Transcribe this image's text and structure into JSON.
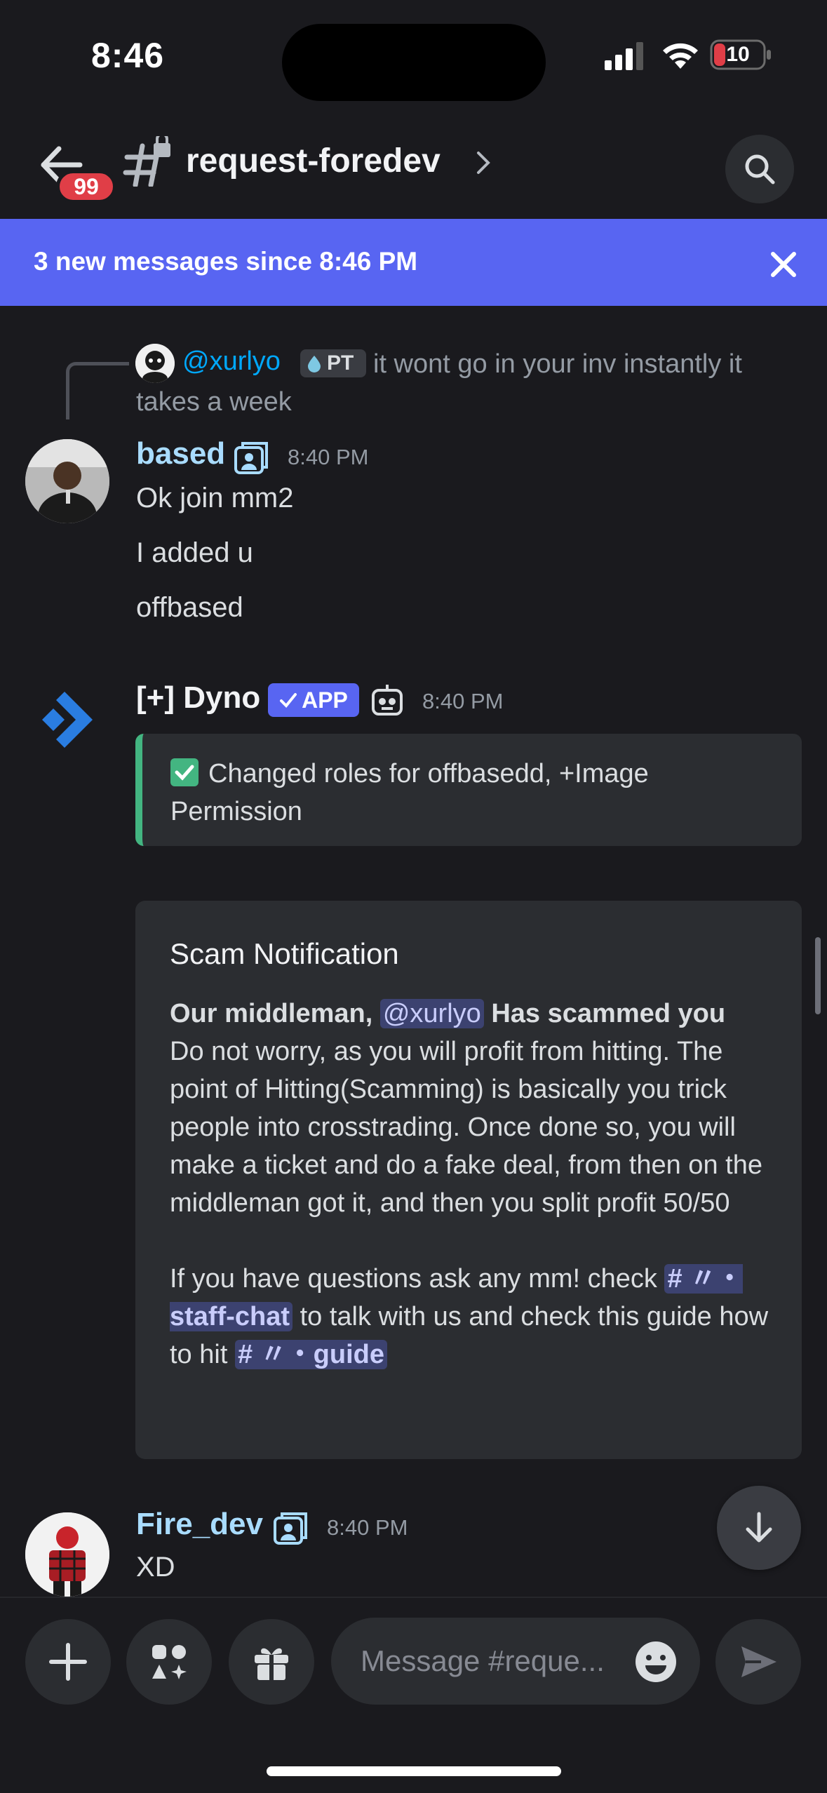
{
  "status": {
    "time": "8:46",
    "battery": "10"
  },
  "header": {
    "unread_badge": "99",
    "channel_name": "request-foredev"
  },
  "banner": {
    "text": "3 new messages since 8:46 PM"
  },
  "reply": {
    "user": "@xurlyo",
    "tag": "PT",
    "text": "it wont go in your inv instantly it takes a week"
  },
  "messages": {
    "based": {
      "username": "based",
      "username_color": "#a9dcff",
      "time": "8:40 PM",
      "lines": [
        "Ok join mm2",
        "I added u",
        "offbased"
      ]
    },
    "dyno": {
      "username": "[+] Dyno",
      "app_tag": "APP",
      "time": "8:40 PM",
      "embed1_text": "Changed roles for offbasedd, +Image Permission",
      "embed2": {
        "title": "Scam Notification",
        "bold_lead": "Our middleman,",
        "mention": "@xurlyo",
        "bold_tail": "Has scammed you",
        "para1": "Do not worry, as you will profit from hitting. The point of Hitting(Scamming) is basically you trick people into crosstrading. Once done so, you will make a ticket and do a fake deal, from then on the middleman got it, and then you split profit 50/50",
        "para2_a": "If you have questions ask any mm! check",
        "channel1": "# 〃・staff-chat",
        "para2_b": "to talk with us and check this guide how to hit",
        "channel2": "# 〃・guide"
      }
    },
    "fire": {
      "username": "Fire_dev",
      "username_color": "#a9dcff",
      "time": "8:40 PM",
      "text": "XD"
    }
  },
  "composer": {
    "placeholder": "Message #reque..."
  },
  "colors": {
    "accent": "#5865f2",
    "mention_bg": "#3c4270",
    "success": "#43b581",
    "danger": "#e03e47"
  }
}
